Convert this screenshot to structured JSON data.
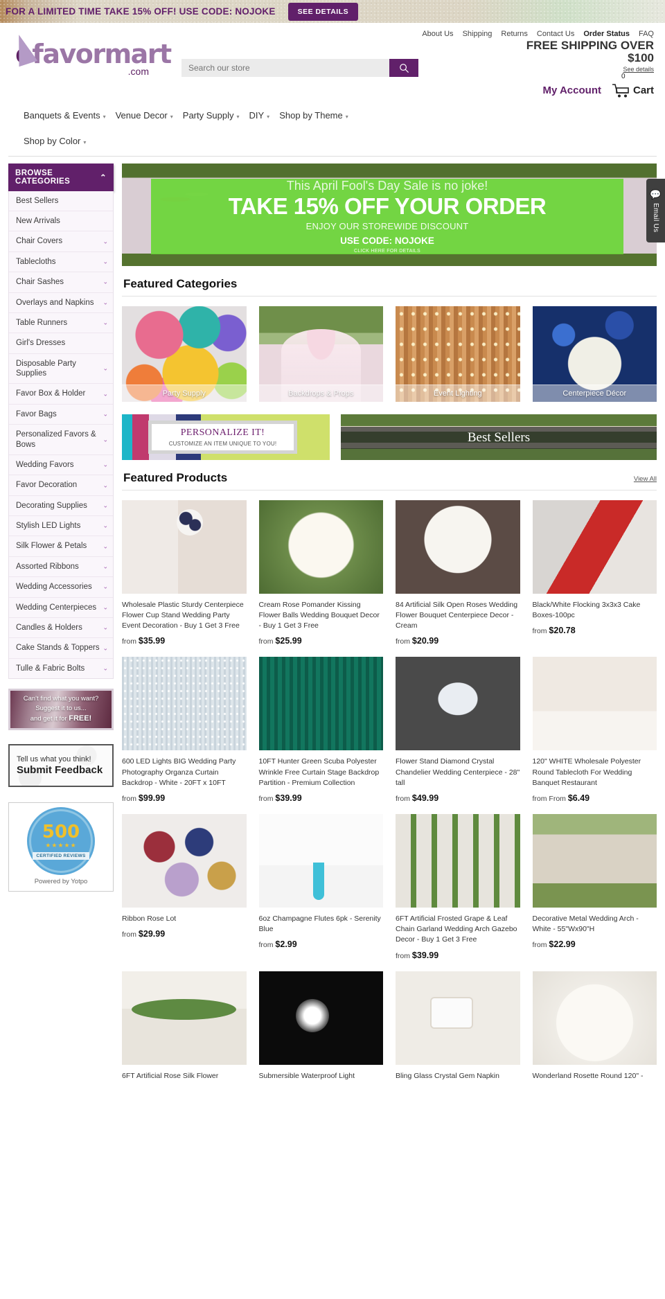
{
  "promo_bar": {
    "text": "FOR A LIMITED TIME TAKE 15% OFF! USE CODE: NOJOKE",
    "button": "SEE DETAILS"
  },
  "utility_nav": [
    {
      "label": "About Us",
      "strong": false
    },
    {
      "label": "Shipping",
      "strong": false
    },
    {
      "label": "Returns",
      "strong": false
    },
    {
      "label": "Contact Us",
      "strong": false
    },
    {
      "label": "Order Status",
      "strong": true
    },
    {
      "label": "FAQ",
      "strong": false
    }
  ],
  "logo": {
    "part1": "e",
    "part2": "favormart",
    "suffix": ".com"
  },
  "search": {
    "placeholder": "Search our store",
    "value": "",
    "icon": "search-icon"
  },
  "shipping_promo": {
    "line1": "FREE SHIPPING OVER",
    "line2": "$100",
    "details_link": "See details"
  },
  "account": {
    "my_account": "My Account",
    "cart_label": "Cart",
    "cart_count": "0"
  },
  "main_nav": [
    {
      "label": "Banquets & Events",
      "caret": true
    },
    {
      "label": "Venue Decor",
      "caret": true
    },
    {
      "label": "Party Supply",
      "caret": true
    },
    {
      "label": "DIY",
      "caret": true
    },
    {
      "label": "Shop by Theme",
      "caret": true
    },
    {
      "label": "Shop by Color",
      "caret": true
    }
  ],
  "sidebar": {
    "header": "BROWSE CATEGORIES",
    "categories": [
      {
        "label": "Best Sellers",
        "chevron": false
      },
      {
        "label": "New Arrivals",
        "chevron": false
      },
      {
        "label": "Chair Covers",
        "chevron": true
      },
      {
        "label": "Tablecloths",
        "chevron": true
      },
      {
        "label": "Chair Sashes",
        "chevron": true
      },
      {
        "label": "Overlays and Napkins",
        "chevron": true
      },
      {
        "label": "Table Runners",
        "chevron": true
      },
      {
        "label": "Girl's Dresses",
        "chevron": false
      },
      {
        "label": "Disposable Party Supplies",
        "chevron": true
      },
      {
        "label": "Favor Box & Holder",
        "chevron": true
      },
      {
        "label": "Favor Bags",
        "chevron": true
      },
      {
        "label": "Personalized Favors & Bows",
        "chevron": true
      },
      {
        "label": "Wedding Favors",
        "chevron": true
      },
      {
        "label": "Favor Decoration",
        "chevron": true
      },
      {
        "label": "Decorating Supplies",
        "chevron": true
      },
      {
        "label": "Stylish LED Lights",
        "chevron": true
      },
      {
        "label": "Silk Flower & Petals",
        "chevron": true
      },
      {
        "label": "Assorted Ribbons",
        "chevron": true
      },
      {
        "label": "Wedding Accessories",
        "chevron": true
      },
      {
        "label": "Wedding Centerpieces",
        "chevron": true
      },
      {
        "label": "Candles & Holders",
        "chevron": true
      },
      {
        "label": "Cake Stands & Toppers",
        "chevron": true
      },
      {
        "label": "Tulle & Fabric Bolts",
        "chevron": true
      }
    ],
    "suggest_box": {
      "line1": "Can't find what you want?",
      "line2": "Suggest it to us...",
      "line3_prefix": "and get it for ",
      "line3_strong": "FREE!"
    },
    "feedback_box": {
      "line1": "Tell us what you think!",
      "line2": "Submit Feedback"
    },
    "reviews_badge": {
      "count": "500",
      "stars": "★★★★★",
      "ribbon": "CERTIFIED REVIEWS",
      "powered_by": "Powered by Yotpo"
    }
  },
  "hero": {
    "line1": "This April Fool's Day Sale is no joke!",
    "line2": "TAKE 15% OFF YOUR ORDER",
    "line3": "ENJOY OUR STOREWIDE DISCOUNT",
    "line4": "USE CODE: NOJOKE",
    "line5": "CLICK HERE FOR DETAILS"
  },
  "featured_categories": {
    "heading": "Featured Categories",
    "tiles": [
      {
        "label": "Party Supply"
      },
      {
        "label": "Backdrops & Props"
      },
      {
        "label": "Event Lighting"
      },
      {
        "label": "Centerpiece Décor"
      }
    ]
  },
  "banners": {
    "personalize": {
      "title": "PERSONALIZE IT!",
      "subtitle": "CUSTOMIZE AN ITEM UNIQUE TO YOU!"
    },
    "best_sellers": {
      "title": "Best Sellers"
    }
  },
  "featured_products": {
    "heading": "Featured Products",
    "view_all": "View All",
    "items": [
      {
        "title": "Wholesale Plastic Sturdy Centerpiece Flower Cup Stand Wedding Party Event Decoration - Buy 1 Get 3 Free",
        "price_prefix": "from",
        "price": "$35.99"
      },
      {
        "title": "Cream Rose Pomander Kissing Flower Balls Wedding Bouquet Decor - Buy 1 Get 3 Free",
        "price_prefix": "from",
        "price": "$25.99"
      },
      {
        "title": "84 Artificial Silk Open Roses Wedding Flower Bouquet Centerpiece Decor - Cream",
        "price_prefix": "from",
        "price": "$20.99"
      },
      {
        "title": "Black/White Flocking 3x3x3 Cake Boxes-100pc",
        "price_prefix": "from",
        "price": "$20.78"
      },
      {
        "title": "600 LED Lights BIG Wedding Party Photography Organza Curtain Backdrop - White - 20FT x 10FT",
        "price_prefix": "from",
        "price": "$99.99"
      },
      {
        "title": "10FT Hunter Green Scuba Polyester Wrinkle Free Curtain Stage Backdrop Partition - Premium Collection",
        "price_prefix": "from",
        "price": "$39.99"
      },
      {
        "title": "Flower Stand Diamond Crystal Chandelier Wedding Centerpiece - 28\" tall",
        "price_prefix": "from",
        "price": "$49.99"
      },
      {
        "title": "120\" WHITE Wholesale Polyester Round Tablecloth For Wedding Banquet Restaurant",
        "price_prefix": "from From",
        "price": "$6.49"
      },
      {
        "title": "Ribbon Rose Lot",
        "price_prefix": "from",
        "price": "$29.99"
      },
      {
        "title": "6oz Champagne Flutes 6pk - Serenity Blue",
        "price_prefix": "from",
        "price": "$2.99"
      },
      {
        "title": "6FT Artificial Frosted Grape & Leaf Chain Garland Wedding Arch Gazebo Decor - Buy 1 Get 3 Free",
        "price_prefix": "from",
        "price": "$39.99"
      },
      {
        "title": "Decorative Metal Wedding Arch - White - 55\"Wx90\"H",
        "price_prefix": "from",
        "price": "$22.99"
      },
      {
        "title": "6FT Artificial Rose Silk Flower",
        "price_prefix": "",
        "price": ""
      },
      {
        "title": "Submersible Waterproof Light",
        "price_prefix": "",
        "price": ""
      },
      {
        "title": "Bling Glass Crystal Gem Napkin",
        "price_prefix": "",
        "price": ""
      },
      {
        "title": "Wonderland Rosette Round 120\" -",
        "price_prefix": "",
        "price": ""
      }
    ]
  },
  "email_tab": {
    "label": "Email Us",
    "icon": "speech-bubble-icon"
  },
  "colors": {
    "brand_purple": "#61206a",
    "promo_green": "#6ad636",
    "sidebar_bg": "#faf6fb"
  }
}
